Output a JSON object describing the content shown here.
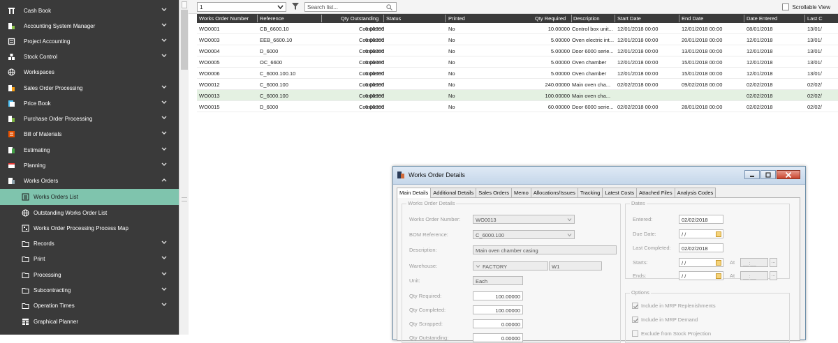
{
  "sidebar": {
    "items": [
      {
        "label": "Cash Book",
        "icon": "cash-book-icon"
      },
      {
        "label": "Accounting System Manager",
        "icon": "accounting-system-manager-icon"
      },
      {
        "label": "Project Accounting",
        "icon": "project-accounting-icon"
      },
      {
        "label": "Stock Control",
        "icon": "stock-control-icon"
      },
      {
        "label": "Workspaces",
        "icon": "globe-icon"
      },
      {
        "label": "Sales Order Processing",
        "icon": "sales-order-processing-icon"
      },
      {
        "label": "Price Book",
        "icon": "price-book-icon"
      },
      {
        "label": "Purchase Order Processing",
        "icon": "purchase-order-processing-icon"
      },
      {
        "label": "Bill of Materials",
        "icon": "bill-of-materials-icon"
      },
      {
        "label": "Estimating",
        "icon": "estimating-icon"
      },
      {
        "label": "Planning",
        "icon": "planning-icon"
      },
      {
        "label": "Works Orders",
        "icon": "works-orders-icon"
      }
    ],
    "sub_items": [
      {
        "label": "Works Orders List",
        "icon": "list-icon"
      },
      {
        "label": "Outstanding Works Order List",
        "icon": "globe-icon"
      },
      {
        "label": "Works Order Processing Process Map",
        "icon": "process-map-icon"
      },
      {
        "label": "Records",
        "icon": "folder-icon"
      },
      {
        "label": "Print",
        "icon": "folder-icon"
      },
      {
        "label": "Processing",
        "icon": "folder-icon"
      },
      {
        "label": "Subcontracting",
        "icon": "folder-icon"
      },
      {
        "label": "Operation Times",
        "icon": "folder-icon"
      },
      {
        "label": "Graphical Planner",
        "icon": "calendar-icon"
      }
    ]
  },
  "toolbar": {
    "view_select": "1",
    "search_placeholder": "Search list...",
    "scrollable_view_label": "Scrollable View"
  },
  "grid": {
    "columns": [
      "Works Order Number",
      "Reference",
      "Qty Outstanding",
      "Status",
      "Printed",
      "Qty Required",
      "Description",
      "Start Date",
      "End Date",
      "Date Entered",
      "Last C"
    ],
    "rows": [
      [
        "WO0001",
        "CB_6600.10",
        "0.00000",
        "Completed",
        "No",
        "10.00000",
        "Control box unit...",
        "12/01/2018 00:00",
        "12/01/2018 00:00",
        "08/01/2018",
        "13/01/"
      ],
      [
        "WO0003",
        "EEB_6600.10",
        "0.00000",
        "Completed",
        "No",
        "5.00000",
        "Oven electric int...",
        "12/01/2018 00:00",
        "20/01/2018 00:00",
        "12/01/2018",
        "13/01/"
      ],
      [
        "WO0004",
        "D_6000",
        "0.00000",
        "Completed",
        "No",
        "5.00000",
        "Door 6000 serie...",
        "12/01/2018 00:00",
        "13/01/2018 00:00",
        "12/01/2018",
        "13/01/"
      ],
      [
        "WO0005",
        "OC_6600",
        "0.00000",
        "Completed",
        "No",
        "5.00000",
        "Oven chamber",
        "12/01/2018 00:00",
        "15/01/2018 00:00",
        "12/01/2018",
        "13/01/"
      ],
      [
        "WO0006",
        "C_6000.100.10",
        "0.00000",
        "Completed",
        "No",
        "5.00000",
        "Oven chamber",
        "12/01/2018 00:00",
        "15/01/2018 00:00",
        "12/01/2018",
        "13/01/"
      ],
      [
        "WO0012",
        "C_6000.100",
        "0.00000",
        "Completed",
        "No",
        "240.00000",
        "Main oven cha...",
        "02/02/2018 00:00",
        "09/02/2018 00:00",
        "02/02/2018",
        "02/02/"
      ],
      [
        "WO0013",
        "C_6000.100",
        "0.00000",
        "Completed",
        "No",
        "100.00000",
        "Main oven cha...",
        "",
        "",
        "02/02/2018",
        "02/02/"
      ],
      [
        "WO0015",
        "D_6000",
        "0.00000",
        "Completed",
        "No",
        "60.00000",
        "Door 6000 serie...",
        "02/02/2018 00:00",
        "28/01/2018 00:00",
        "02/02/2018",
        "02/02/"
      ]
    ]
  },
  "dialog": {
    "title": "Works Order Details",
    "tabs": [
      "Main Details",
      "Additional Details",
      "Sales Orders",
      "Memo",
      "Allocations/Issues",
      "Tracking",
      "Latest Costs",
      "Attached Files",
      "Analysis Codes"
    ],
    "main_group_title": "Works Order Details",
    "labels": {
      "works_order_number": "Works Order Number:",
      "bom_reference": "BOM Reference:",
      "description": "Description:",
      "warehouse": "Warehouse:",
      "unit": "Unit:",
      "qty_required": "Qty Required:",
      "qty_completed": "Qty Completed:",
      "qty_scrapped": "Qty Scrapped:",
      "qty_outstanding": "Qty Outstanding:"
    },
    "values": {
      "works_order_number": "WO0013",
      "bom_reference": "C_6000.100",
      "description": "Main oven chamber casing",
      "warehouse_name": "FACTORY",
      "warehouse_code": "W1",
      "unit": "Each",
      "qty_required": "100.00000",
      "qty_completed": "100.00000",
      "qty_scrapped": "0.00000",
      "qty_outstanding": "0.00000"
    },
    "dates": {
      "title": "Dates",
      "entered_label": "Entered:",
      "entered": "02/02/2018",
      "due_label": "Due Date:",
      "due": "/ /",
      "last_completed_label": "Last Completed:",
      "last_completed": "02/02/2018",
      "starts_label": "Starts:",
      "starts": "/ /",
      "ends_label": "Ends:",
      "ends": "/ /",
      "at_label": "At",
      "time_value": "__:__",
      "ellipsis": "..."
    },
    "options": {
      "title": "Options",
      "include_mrp_replenishments": "Include in MRP Replenishments",
      "include_mrp_demand": "Include in MRP Demand",
      "exclude_stock_projection": "Exclude from Stock Projection"
    }
  },
  "colors": {
    "sidebar_bg": "#3a3a3a",
    "active_item": "#7fc4ad",
    "grid_header": "#3a3a3a",
    "selected_row": "#e4f1e2"
  }
}
